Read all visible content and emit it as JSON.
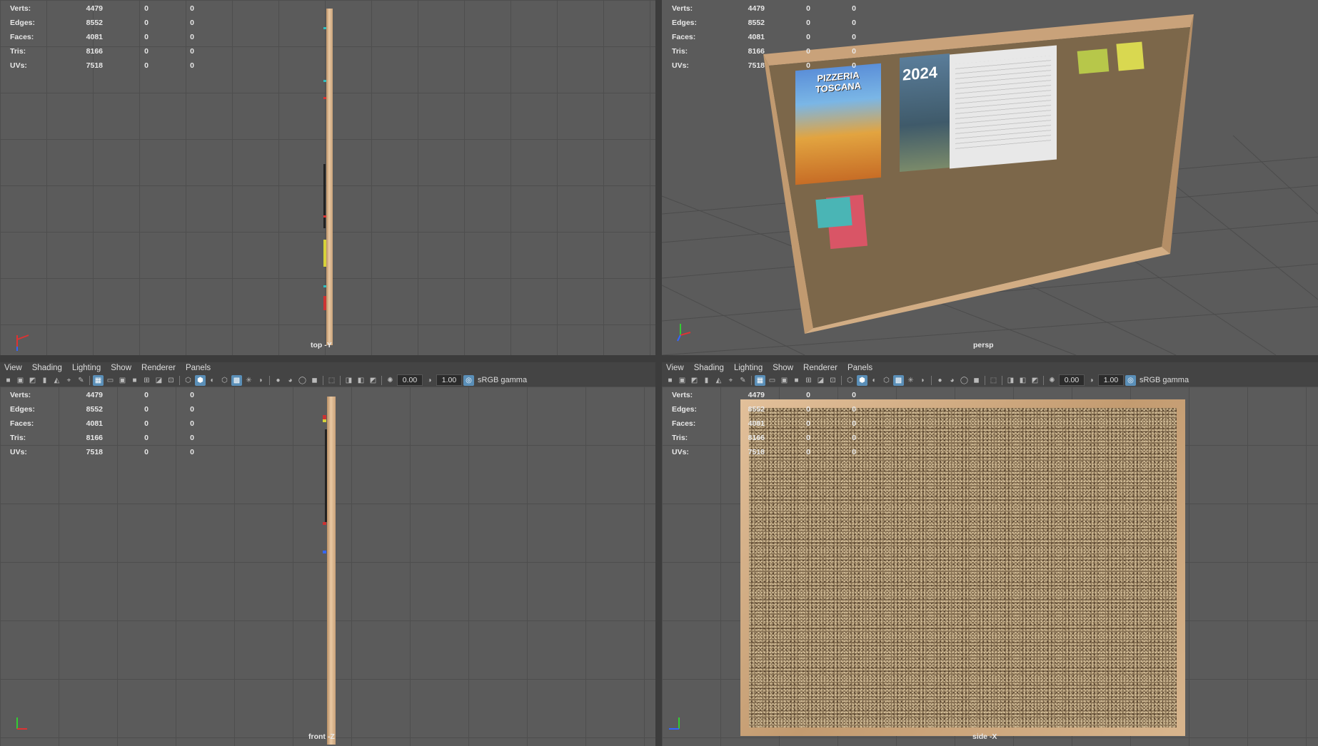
{
  "hud": {
    "labels": [
      "Verts:",
      "Edges:",
      "Faces:",
      "Tris:",
      "UVs:"
    ],
    "values": [
      "4479",
      "8552",
      "4081",
      "8166",
      "7518"
    ],
    "zero": "0"
  },
  "cameras": {
    "top": "top -Y",
    "persp": "persp",
    "front": "front -Z",
    "side": "side -X"
  },
  "panel_menu": [
    "View",
    "Shading",
    "Lighting",
    "Show",
    "Renderer",
    "Panels"
  ],
  "toolbar": {
    "exposure": "0.00",
    "gamma_value": "1.00",
    "colorspace": "sRGB gamma"
  },
  "persp_scene": {
    "poster_title": "PIZZERIA TOSCANA",
    "calendar_year": "2024"
  },
  "colors": {
    "viewport_bg": "#5b5b5b",
    "grid_line": "#4e4e4e",
    "toolbar_active": "#5a8fb8",
    "frame_wood": "#c9a27a",
    "cork": "#8a7456"
  }
}
